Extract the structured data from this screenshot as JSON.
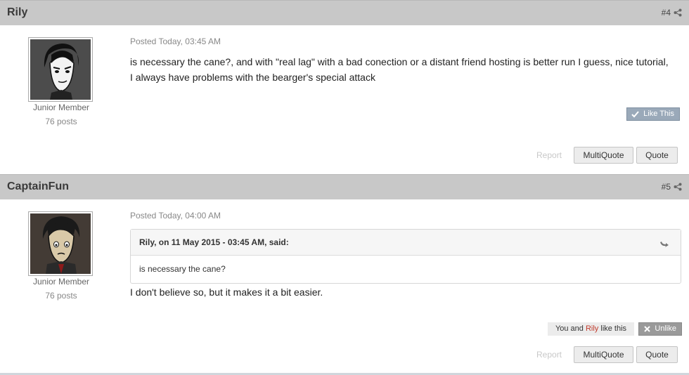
{
  "posts": [
    {
      "author": "Rily",
      "number": "#4",
      "rank": "Junior Member",
      "post_count": "76 posts",
      "posted": "Posted Today, 03:45 AM",
      "body_line1": "is necessary the cane?, and with \"real lag\" with a bad conection or a distant friend hosting is better run I guess, nice tutorial,",
      "body_line2": "I always have problems with the bearger's special attack",
      "like_label": "Like This",
      "report_label": "Report",
      "multiquote_label": "MultiQuote",
      "quote_label": "Quote"
    },
    {
      "author": "CaptainFun",
      "number": "#5",
      "rank": "Junior Member",
      "post_count": "76 posts",
      "posted": "Posted Today, 04:00 AM",
      "quote": {
        "citation": "Rily, on 11 May 2015 - 03:45 AM, said:",
        "text": "is necessary the cane?"
      },
      "body": "I don't believe so, but it makes it a bit easier.",
      "likers": {
        "prefix": "You and ",
        "name": "Rily",
        "suffix": " like this"
      },
      "unlike_label": "Unlike",
      "report_label": "Report",
      "multiquote_label": "MultiQuote",
      "quote_label": "Quote"
    }
  ],
  "icons": {
    "share": "share-icon",
    "like": "checkmark-icon",
    "unlike": "close-icon",
    "quote_jump": "reply-arrow-icon"
  }
}
